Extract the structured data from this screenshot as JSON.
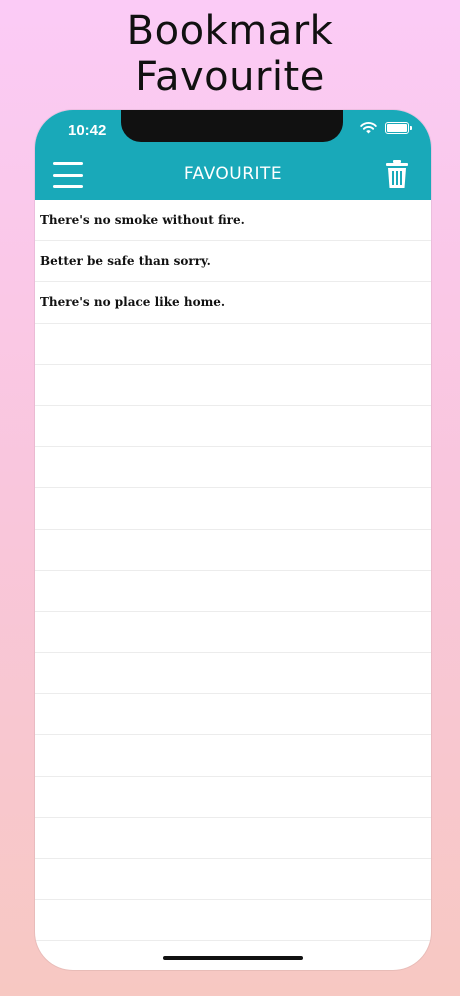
{
  "headline": {
    "line1": "Bookmark",
    "line2": "Favourite"
  },
  "status_bar": {
    "time": "10:42",
    "wifi_icon": "wifi-icon",
    "battery_icon": "battery-icon"
  },
  "nav_bar": {
    "title": "FAVOURITE",
    "menu_icon": "hamburger-menu-icon",
    "delete_icon": "trash-icon",
    "color": "#19a9b9"
  },
  "favourites": [
    "There's no smoke without fire.",
    "Better be safe than sorry.",
    "There's no place like home."
  ]
}
